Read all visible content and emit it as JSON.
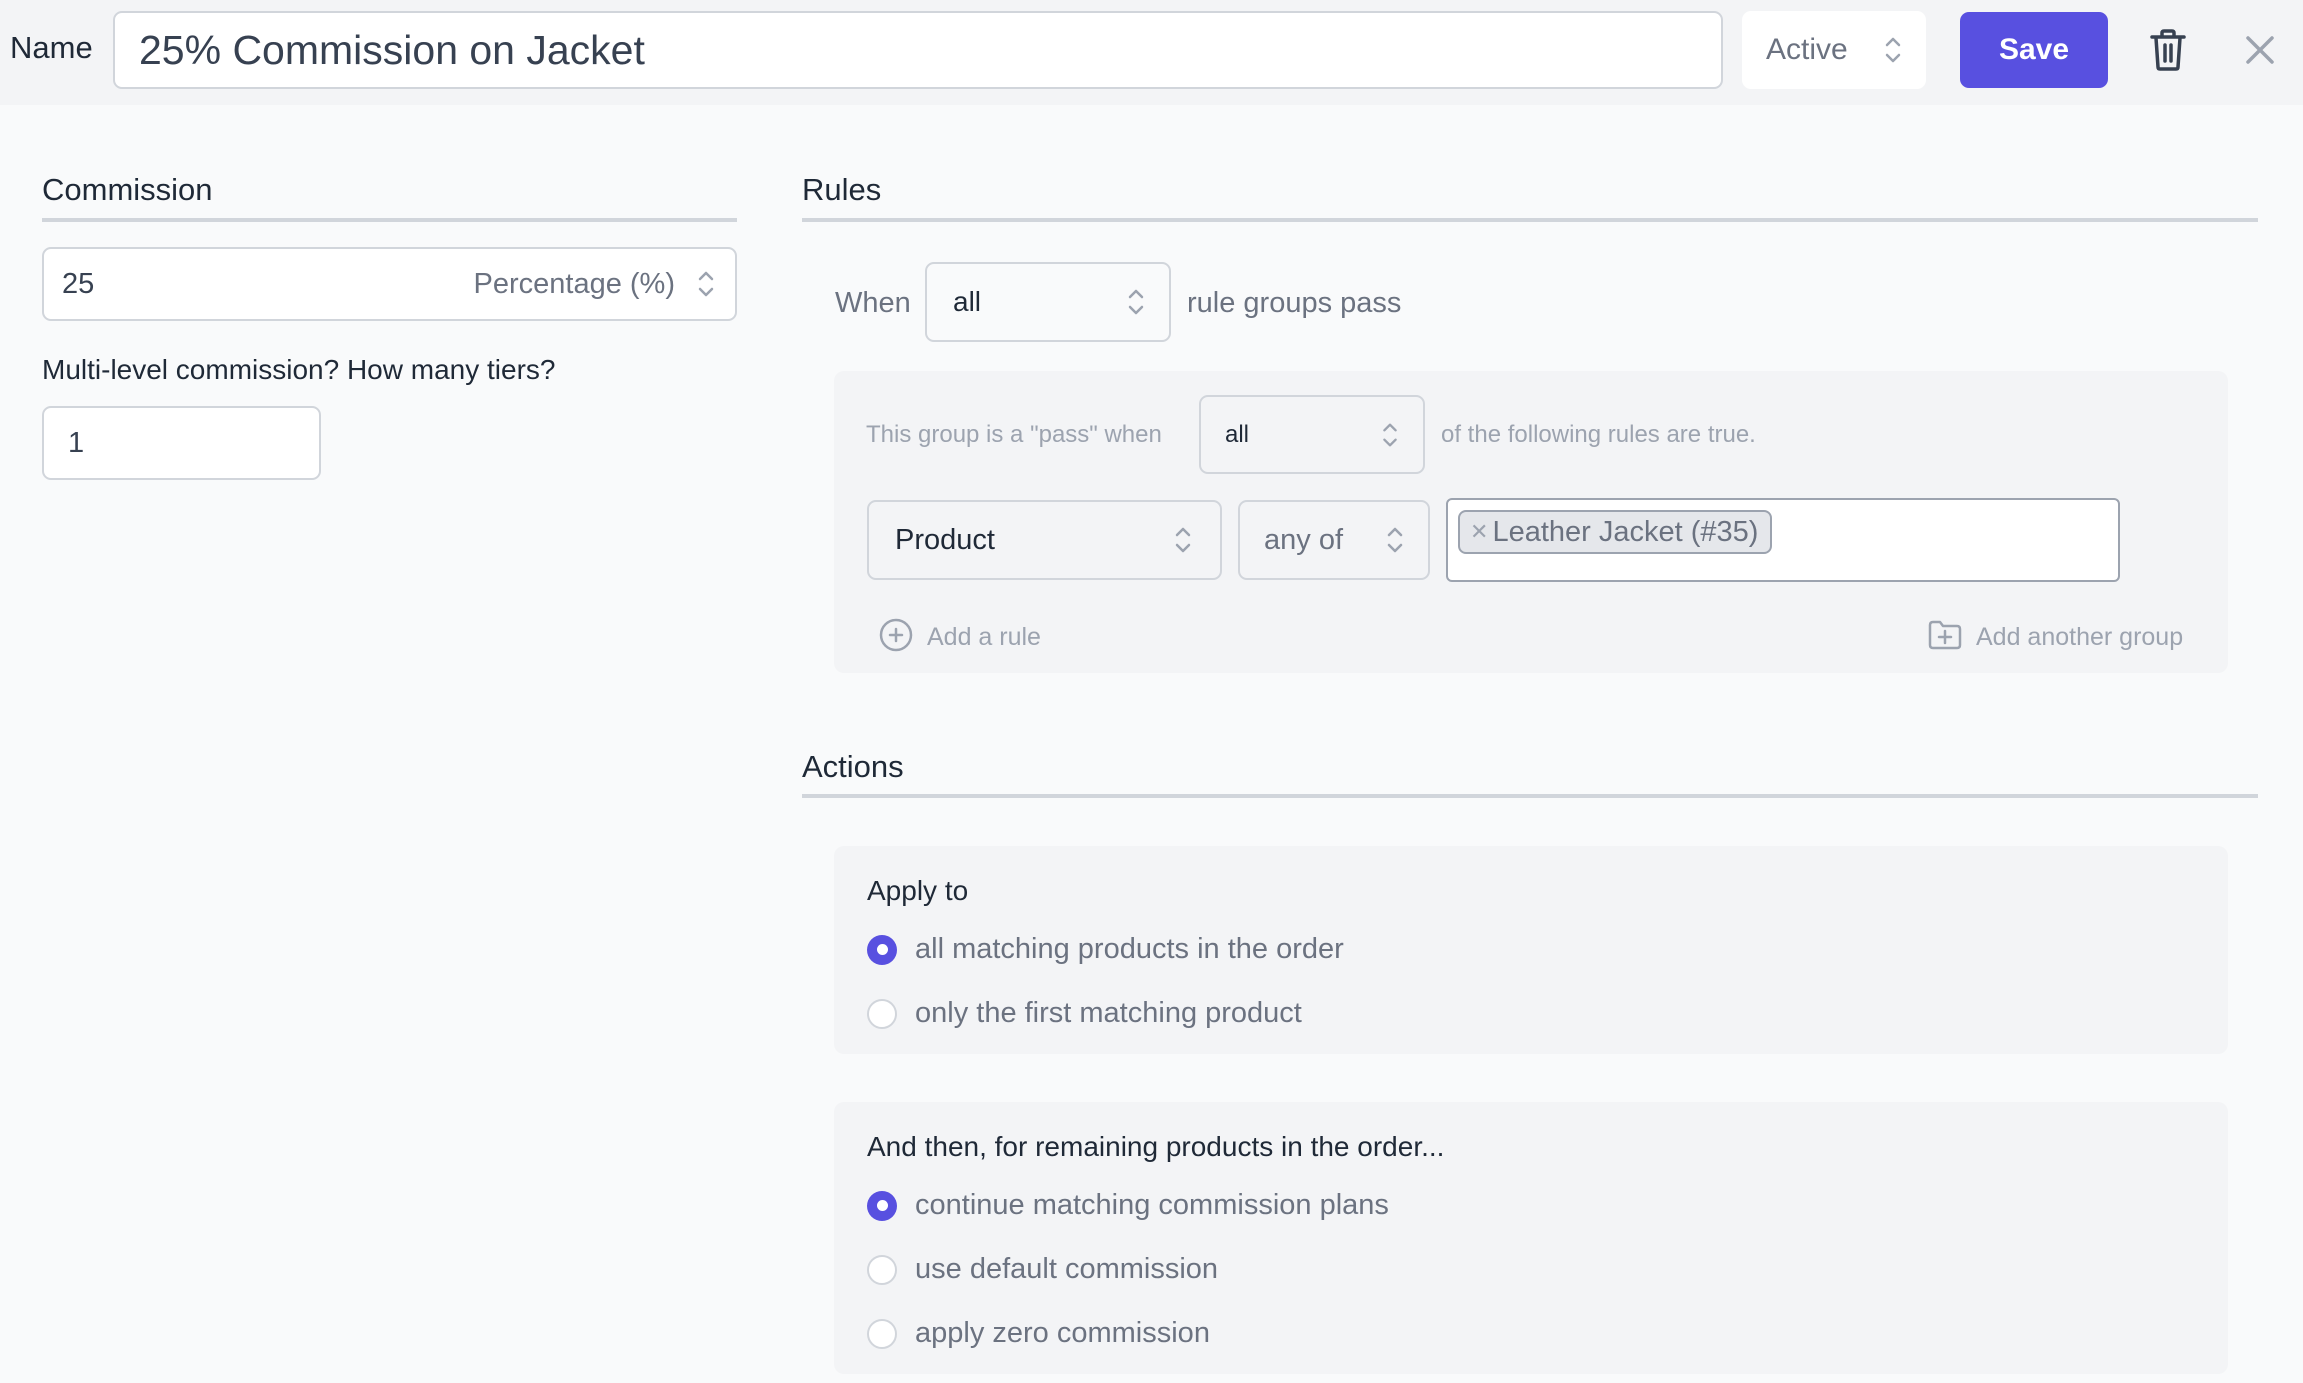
{
  "header": {
    "name_label": "Name",
    "name_value": "25% Commission on Jacket",
    "status_value": "Active",
    "save_label": "Save"
  },
  "commission": {
    "title": "Commission",
    "amount": "25",
    "type_value": "Percentage (%)",
    "tiers_label": "Multi-level commission? How many tiers?",
    "tiers_value": "1"
  },
  "rules": {
    "title": "Rules",
    "when_label": "When",
    "when_value": "all",
    "when_suffix": "rule groups pass",
    "group": {
      "pass_prefix": "This group is a \"pass\" when",
      "pass_value": "all",
      "pass_suffix": "of the following rules are true.",
      "rule": {
        "field": "Product",
        "operator": "any of",
        "values": [
          "Leather Jacket (#35)"
        ]
      },
      "add_rule_label": "Add a rule",
      "add_group_label": "Add another group"
    }
  },
  "actions": {
    "title": "Actions",
    "apply_to": {
      "title": "Apply to",
      "options": [
        {
          "label": "all matching products in the order",
          "selected": true
        },
        {
          "label": "only the first matching product",
          "selected": false
        }
      ]
    },
    "remaining": {
      "title": "And then, for remaining products in the order...",
      "options": [
        {
          "label": "continue matching commission plans",
          "selected": true
        },
        {
          "label": "use default commission",
          "selected": false
        },
        {
          "label": "apply zero commission",
          "selected": false
        }
      ]
    }
  },
  "colors": {
    "accent": "#5850e0",
    "background": "#f9fafb",
    "header_background": "#f3f4f6"
  }
}
